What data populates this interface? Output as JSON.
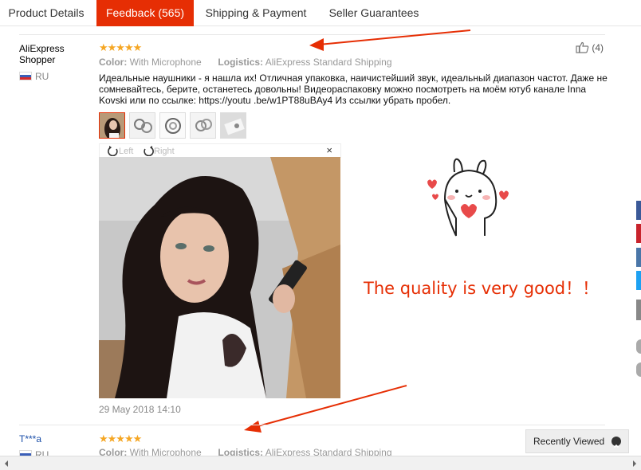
{
  "tabs": [
    {
      "label": "Product Details",
      "active": false
    },
    {
      "label": "Feedback (565)",
      "active": true
    },
    {
      "label": "Shipping & Payment",
      "active": false
    },
    {
      "label": "Seller Guarantees",
      "active": false
    }
  ],
  "reviews": [
    {
      "user": "AliExpress Shopper",
      "country": "RU",
      "stars": "★★★★★",
      "color_key": "Color:",
      "color_value": "With Microphone",
      "logistics_key": "Logistics:",
      "logistics_value": "AliExpress Standard Shipping",
      "helpful_count": "(4)",
      "text": "Идеальные наушники - я нашла их! Отличная упаковка, наичистейший звук, идеальный диапазон частот. Даже не сомневайтесь, берите, останетесь довольны! Видеораспаковку можно посмотреть на моём ютуб канале Inna Kovski или по ссылке: https://youtu .be/w1PT88uBAy4 Из ссылки убрать пробел.",
      "rotate_left": "Left",
      "rotate_right": "Right",
      "close": "×",
      "date": "29 May 2018 14:10"
    },
    {
      "user": "T***a",
      "country": "RU",
      "stars": "★★★★★",
      "color_key": "Color:",
      "color_value": "With Microphone",
      "logistics_key": "Logistics:",
      "logistics_value": "AliExpress Standard Shipping"
    }
  ],
  "annotation": "The quality is very good！！",
  "recently_viewed": "Recently Viewed",
  "colors": {
    "accent": "#e62e04",
    "star": "#f5a623",
    "link": "#1a4ea8"
  }
}
